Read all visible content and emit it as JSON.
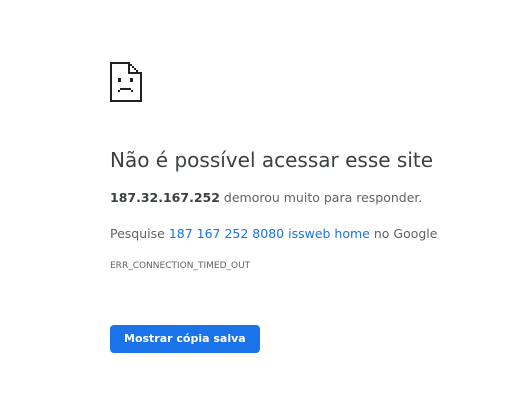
{
  "error_page": {
    "icon": "sad-page-icon",
    "heading": "Não é possível acessar esse site",
    "host": "187.32.167.252",
    "host_suffix": " demorou muito para responder.",
    "search_prefix": "Pesquise ",
    "search_link": "187 167 252 8080 issweb home",
    "search_suffix": " no Google",
    "error_code": "ERR_CONNECTION_TIMED_OUT",
    "button_label": "Mostrar cópia salva"
  },
  "colors": {
    "accent": "#1a73e8",
    "heading": "#3c4043",
    "body_text": "#5f6368",
    "background": "#ffffff"
  }
}
